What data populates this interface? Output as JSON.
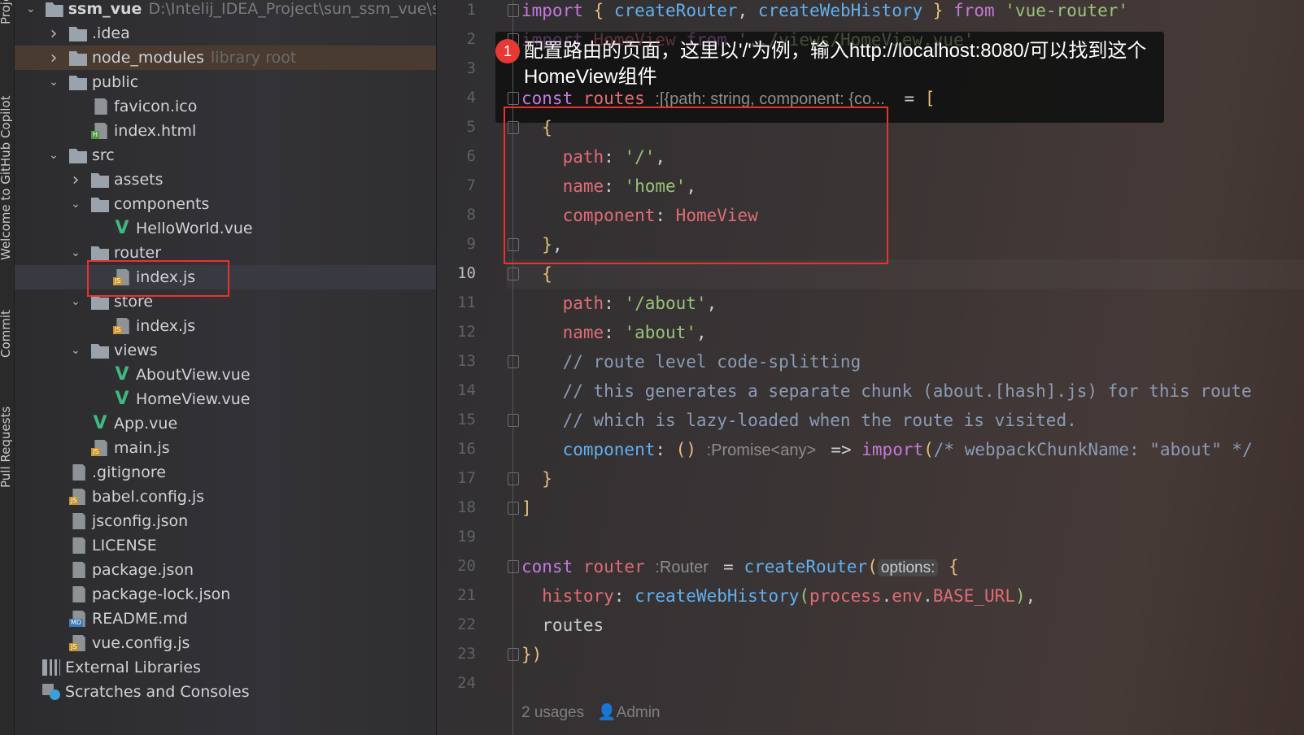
{
  "side_tabs": [
    "Project",
    "Welcome to GitHub Copilot",
    "Commit",
    "Pull Requests"
  ],
  "tree": [
    {
      "label": "ssm_vue",
      "extra": "D:\\Intelij_IDEA_Project\\sun_ssm_vue\\ssm_vue",
      "depth": 0,
      "chev": "down",
      "icon": "project-folder-icon",
      "bold": true
    },
    {
      "label": ".idea",
      "depth": 1,
      "chev": "right",
      "icon": "folder-icon"
    },
    {
      "label": "node_modules",
      "hint": "library root",
      "depth": 1,
      "chev": "right",
      "icon": "folder-icon",
      "hl": true
    },
    {
      "label": "public",
      "depth": 1,
      "chev": "down",
      "icon": "folder-icon"
    },
    {
      "label": "favicon.ico",
      "depth": 2,
      "icon": "image-file-icon"
    },
    {
      "label": "index.html",
      "depth": 2,
      "icon": "html-file-icon",
      "badge": "H",
      "badgeColor": "#4e9a3e"
    },
    {
      "label": "src",
      "depth": 1,
      "chev": "down",
      "icon": "folder-icon"
    },
    {
      "label": "assets",
      "depth": 2,
      "chev": "right",
      "icon": "folder-icon"
    },
    {
      "label": "components",
      "depth": 2,
      "chev": "down",
      "icon": "folder-icon"
    },
    {
      "label": "HelloWorld.vue",
      "depth": 3,
      "icon": "vue-file-icon"
    },
    {
      "label": "router",
      "depth": 2,
      "chev": "down",
      "icon": "folder-icon"
    },
    {
      "label": "index.js",
      "depth": 3,
      "icon": "js-file-icon",
      "badge": "JS",
      "badgeColor": "#c7932b",
      "sel": true
    },
    {
      "label": "store",
      "depth": 2,
      "chev": "down",
      "icon": "folder-icon"
    },
    {
      "label": "index.js",
      "depth": 3,
      "icon": "js-file-icon",
      "badge": "JS",
      "badgeColor": "#c7932b"
    },
    {
      "label": "views",
      "depth": 2,
      "chev": "down",
      "icon": "folder-icon"
    },
    {
      "label": "AboutView.vue",
      "depth": 3,
      "icon": "vue-file-icon"
    },
    {
      "label": "HomeView.vue",
      "depth": 3,
      "icon": "vue-file-icon"
    },
    {
      "label": "App.vue",
      "depth": 2,
      "icon": "vue-file-icon"
    },
    {
      "label": "main.js",
      "depth": 2,
      "icon": "js-file-icon",
      "badge": "JS",
      "badgeColor": "#c7932b"
    },
    {
      "label": ".gitignore",
      "depth": 1,
      "icon": "gitignore-file-icon"
    },
    {
      "label": "babel.config.js",
      "depth": 1,
      "icon": "js-file-icon",
      "badge": "JS",
      "badgeColor": "#c7932b"
    },
    {
      "label": "jsconfig.json",
      "depth": 1,
      "icon": "json-file-icon"
    },
    {
      "label": "LICENSE",
      "depth": 1,
      "icon": "text-file-icon"
    },
    {
      "label": "package.json",
      "depth": 1,
      "icon": "json-file-icon"
    },
    {
      "label": "package-lock.json",
      "depth": 1,
      "icon": "json-file-icon"
    },
    {
      "label": "README.md",
      "depth": 1,
      "icon": "markdown-file-icon",
      "badge": "MD",
      "badgeColor": "#3d7ab8"
    },
    {
      "label": "vue.config.js",
      "depth": 1,
      "icon": "js-file-icon",
      "badge": "JS",
      "badgeColor": "#c7932b"
    },
    {
      "label": "External Libraries",
      "depth": 0,
      "icon": "libraries-icon"
    },
    {
      "label": "Scratches and Consoles",
      "depth": 0,
      "icon": "scratches-icon"
    }
  ],
  "editor": {
    "current_line": 10,
    "lines": [
      [
        [
          "kw",
          "import "
        ],
        [
          "br",
          "{ "
        ],
        [
          "fn",
          "createRouter"
        ],
        [
          "tx",
          ", "
        ],
        [
          "fn",
          "createWebHistory"
        ],
        [
          "br",
          " } "
        ],
        [
          "kw",
          "from "
        ],
        [
          "st",
          "'vue-router'"
        ]
      ],
      [
        [
          "kw",
          "import "
        ],
        [
          "pr",
          "HomeView "
        ],
        [
          "kw",
          "from "
        ],
        [
          "st",
          "'../views/HomeView.vue'"
        ]
      ],
      [],
      [
        [
          "kw",
          "const "
        ],
        [
          "pr",
          "routes "
        ],
        [
          "hn",
          ":[{path: string, component: {co...  "
        ],
        [
          "tx",
          " = "
        ],
        [
          "br",
          "["
        ]
      ],
      [
        [
          "br",
          "  {"
        ]
      ],
      [
        [
          "pr",
          "    path"
        ],
        [
          "tx",
          ": "
        ],
        [
          "st",
          "'/'"
        ],
        [
          "tx",
          ","
        ]
      ],
      [
        [
          "pr",
          "    name"
        ],
        [
          "tx",
          ": "
        ],
        [
          "st",
          "'home'"
        ],
        [
          "tx",
          ","
        ]
      ],
      [
        [
          "pr",
          "    component"
        ],
        [
          "tx",
          ": "
        ],
        [
          "pr",
          "HomeView"
        ]
      ],
      [
        [
          "br",
          "  }"
        ],
        [
          "tx",
          ","
        ]
      ],
      [
        [
          "br",
          "  {"
        ]
      ],
      [
        [
          "pr",
          "    path"
        ],
        [
          "tx",
          ": "
        ],
        [
          "st",
          "'/about'"
        ],
        [
          "tx",
          ","
        ]
      ],
      [
        [
          "pr",
          "    name"
        ],
        [
          "tx",
          ": "
        ],
        [
          "st",
          "'about'"
        ],
        [
          "tx",
          ","
        ]
      ],
      [
        [
          "cm",
          "    // route level code-splitting"
        ]
      ],
      [
        [
          "cm",
          "    // this generates a separate chunk (about.[hash].js) for this route"
        ]
      ],
      [
        [
          "cm",
          "    // which is lazy-loaded when the route is visited."
        ]
      ],
      [
        [
          "fn",
          "    component"
        ],
        [
          "tx",
          ": "
        ],
        [
          "br",
          "() "
        ],
        [
          "hn",
          ":Promise<any> "
        ],
        [
          "tx",
          " => "
        ],
        [
          "kw",
          "import"
        ],
        [
          "br",
          "("
        ],
        [
          "cm",
          "/* webpackChunkName: \"about\" */"
        ]
      ],
      [
        [
          "br",
          "  }"
        ]
      ],
      [
        [
          "br",
          "]"
        ]
      ],
      [],
      [
        [
          "kw",
          "const "
        ],
        [
          "pr",
          "router "
        ],
        [
          "hn",
          ":Router "
        ],
        [
          "tx",
          " = "
        ],
        [
          "fn",
          "createRouter"
        ],
        [
          "br",
          "("
        ],
        [
          "hnb",
          "options:"
        ],
        [
          "br",
          " {"
        ]
      ],
      [
        [
          "pr",
          "  history"
        ],
        [
          "tx",
          ": "
        ],
        [
          "fn",
          "createWebHistory"
        ],
        [
          "st",
          "("
        ],
        [
          "pr",
          "process"
        ],
        [
          "tx",
          "."
        ],
        [
          "pr",
          "env"
        ],
        [
          "tx",
          "."
        ],
        [
          "pr",
          "BASE_URL"
        ],
        [
          "st",
          ")"
        ],
        [
          "tx",
          ","
        ]
      ],
      [
        [
          "tx",
          "  routes"
        ]
      ],
      [
        [
          "br",
          "})"
        ]
      ],
      []
    ],
    "usages": "2 usages",
    "author": "Admin"
  },
  "annotation": {
    "step": "1",
    "text": "配置路由的页面，这里以'/'为例，输入http://localhost:8080/可以找到这个HomeView组件",
    "accent": "#e8322f"
  }
}
